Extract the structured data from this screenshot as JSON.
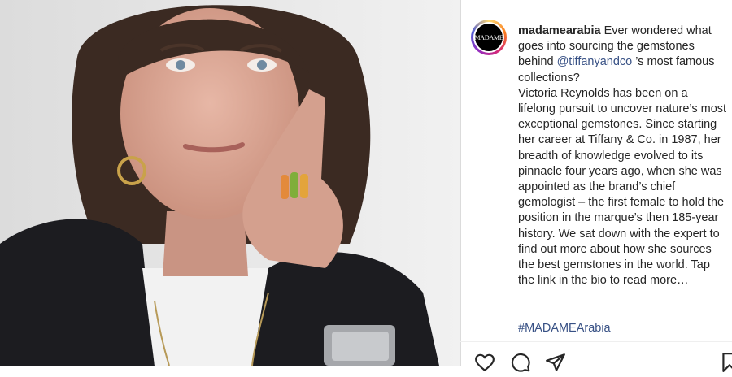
{
  "post": {
    "avatar_text": "MADAME",
    "username": "madamearabia",
    "caption_lead": " Ever wondered what goes into sourcing the gemstones behind ",
    "mention": "@tiffanyandco",
    "caption_after_mention": " ’s most famous collections?",
    "caption_body": "Victoria Reynolds has been on a lifelong pursuit to uncover nature’s most exceptional gemstones. Since starting her career at Tiffany & Co. in 1987, her breadth of knowledge evolved to its pinnacle four years ago, when she was appointed as the brand’s chief gemologist – the first female to hold the position in the marque’s then 185-year history. We sat down with the expert to find out more about how she sources the best gemstones in the world. Tap the link in the bio to read more…",
    "hashtag": "#MADAMEArabia"
  },
  "actions": {
    "icons": [
      "heart-icon",
      "comment-icon",
      "share-icon",
      "bookmark-icon"
    ]
  },
  "colors": {
    "link": "#385185",
    "text": "#262626",
    "border": "#dbdbdb"
  }
}
